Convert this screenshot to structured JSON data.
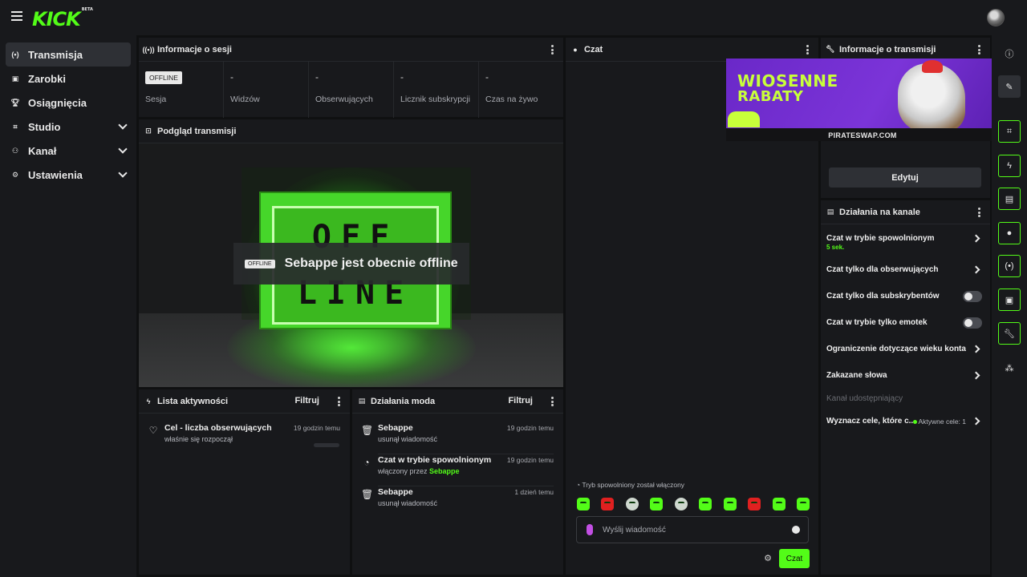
{
  "brand": {
    "logo": "KICK",
    "beta": "BETA",
    "accent": "#53fc18"
  },
  "nav": {
    "items": [
      {
        "label": "Transmisja",
        "icon": "broadcast-icon"
      },
      {
        "label": "Zarobki",
        "icon": "wallet-icon"
      },
      {
        "label": "Osiągnięcia",
        "icon": "trophy-icon"
      },
      {
        "label": "Studio",
        "icon": "studio-icon"
      },
      {
        "label": "Kanał",
        "icon": "channel-icon"
      },
      {
        "label": "Ustawienia",
        "icon": "gear-icon"
      }
    ]
  },
  "session": {
    "title": "Informacje o sesji",
    "stats": [
      {
        "value": "OFFLINE",
        "label": "Sesja"
      },
      {
        "value": "-",
        "label": "Widzów"
      },
      {
        "value": "-",
        "label": "Obserwujących"
      },
      {
        "value": "-",
        "label": "Licznik subskrypcji"
      },
      {
        "value": "-",
        "label": "Czas na żywo"
      }
    ]
  },
  "preview": {
    "title": "Podgląd transmisji",
    "sign_text": "OFF LINE",
    "badge": "OFFLINE",
    "status_text": "Sebappe jest obecnie offline"
  },
  "activity": {
    "title": "Lista aktywności",
    "filter_label": "Filtruj",
    "items": [
      {
        "title": "Cel - liczba obserwujących",
        "subtitle": "właśnie się rozpoczął",
        "time": "19 godzin temu"
      }
    ]
  },
  "mod": {
    "title": "Działania moda",
    "filter_label": "Filtruj",
    "items": [
      {
        "title": "Sebappe",
        "subtitle": "usunął wiadomość",
        "time": "19 godzin temu"
      },
      {
        "title": "Czat w trybie spowolnionym",
        "subtitle_prefix": "włączony przez",
        "subtitle_user": "Sebappe",
        "time": "19 godzin temu"
      },
      {
        "title": "Sebappe",
        "subtitle": "usunął wiadomość",
        "time": "1 dzień temu"
      }
    ]
  },
  "chat": {
    "title": "Czat",
    "slow_mode_notice": "Tryb spowolniony został włączony",
    "input_placeholder": "Wyślij wiadomość",
    "send_label": "Czat"
  },
  "stream_info": {
    "title": "Informacje o transmisji",
    "ad": {
      "line1": "WIOSENNE",
      "line2": "RABATY",
      "url": "PIRATESWAP.COM"
    },
    "edit_label": "Edytuj"
  },
  "channel_actions": {
    "title": "Działania na kanale",
    "items": [
      {
        "label": "Czat w trybie spowolnionym",
        "sub": "5 sek.",
        "control": "arrow"
      },
      {
        "label": "Czat tylko dla obserwujących",
        "control": "arrow"
      },
      {
        "label": "Czat tylko dla subskrybentów",
        "control": "toggle",
        "on": false
      },
      {
        "label": "Czat w trybie tylko emotek",
        "control": "toggle",
        "on": false
      },
      {
        "label": "Ograniczenie dotyczące wieku konta",
        "control": "arrow"
      },
      {
        "label": "Zakazane słowa",
        "control": "arrow"
      },
      {
        "label": "Kanał udostępniający",
        "control": "none"
      },
      {
        "label": "Wyznacz cele, które c...",
        "goal": "Aktywne cele: 1",
        "control": "arrow"
      }
    ]
  },
  "rail": {
    "icons": [
      "info-icon",
      "pencil-icon",
      "scan-icon",
      "bolt-icon",
      "document-icon",
      "chat-bubble-icon",
      "broadcast-icon",
      "server-icon",
      "wrench-icon",
      "people-icon"
    ]
  }
}
